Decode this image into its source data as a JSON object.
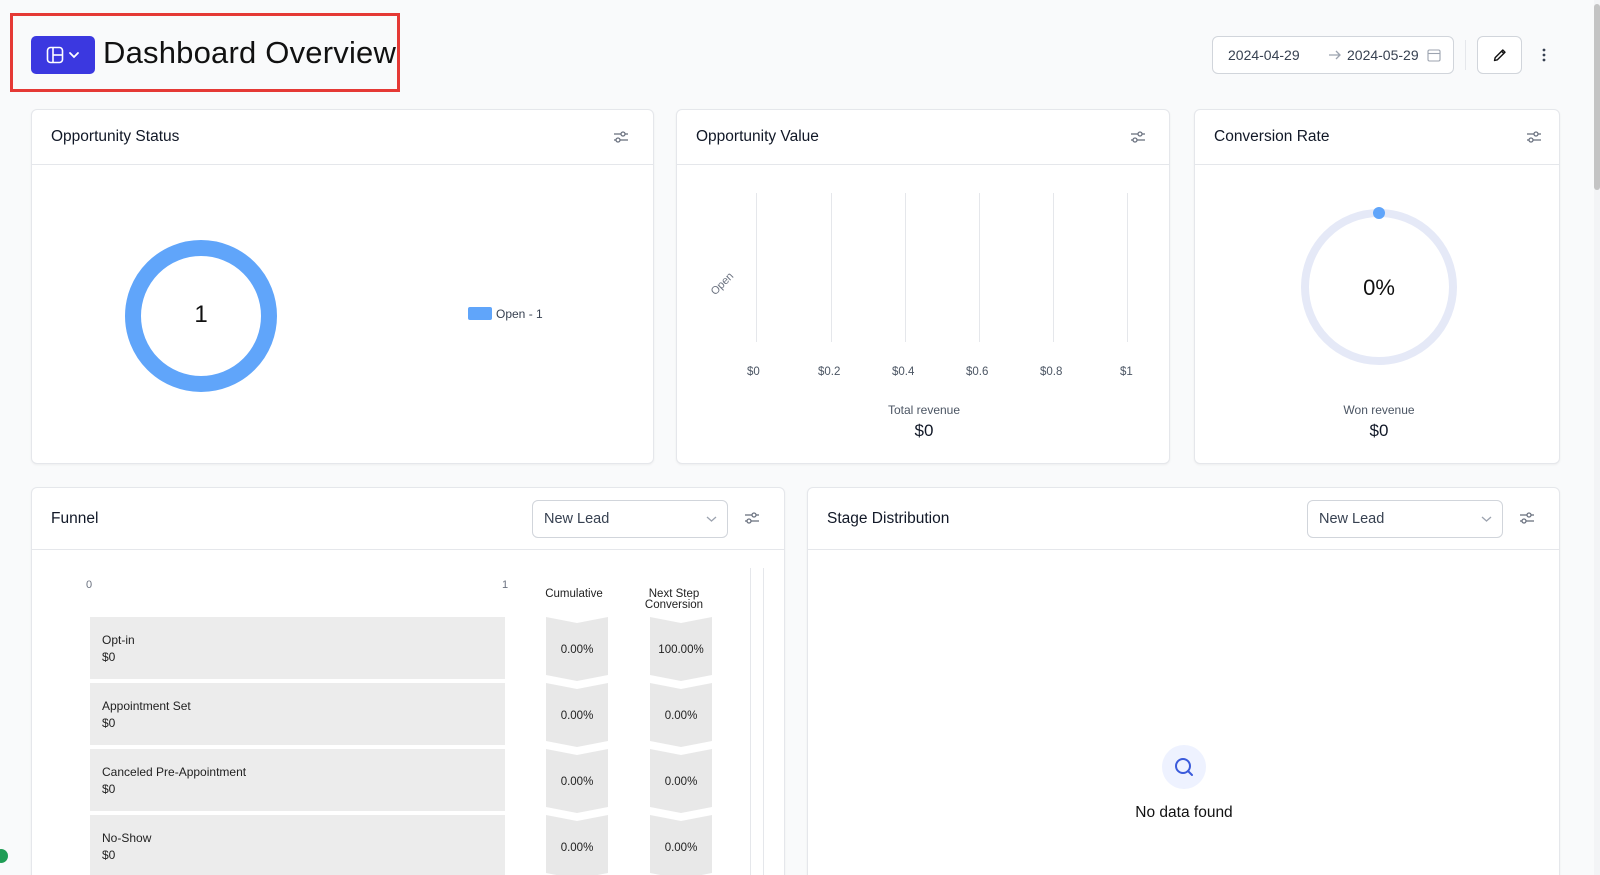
{
  "header": {
    "title": "Dashboard Overview",
    "date_start": "2024-04-29",
    "date_end": "2024-05-29"
  },
  "opportunity_status": {
    "title": "Opportunity Status",
    "center_value": "1",
    "legend": "Open - 1",
    "color": "#60a5fa"
  },
  "opportunity_value": {
    "title": "Opportunity Value",
    "category": "Open",
    "ticks": [
      "$0",
      "$0.2",
      "$0.4",
      "$0.6",
      "$0.8",
      "$1"
    ],
    "kpi_label": "Total revenue",
    "kpi_value": "$0"
  },
  "conversion_rate": {
    "title": "Conversion Rate",
    "center_value": "0%",
    "kpi_label": "Won revenue",
    "kpi_value": "$0"
  },
  "funnel": {
    "title": "Funnel",
    "select_value": "New Lead",
    "axis_min": "0",
    "axis_max": "1",
    "col_cumulative": "Cumulative",
    "col_next_line1": "Next Step",
    "col_next_line2": "Conversion",
    "rows": [
      {
        "label": "Opt-in",
        "amount": "$0",
        "cumulative": "0.00%",
        "next": "100.00%"
      },
      {
        "label": "Appointment Set",
        "amount": "$0",
        "cumulative": "0.00%",
        "next": "0.00%"
      },
      {
        "label": "Canceled Pre-Appointment",
        "amount": "$0",
        "cumulative": "0.00%",
        "next": "0.00%"
      },
      {
        "label": "No-Show",
        "amount": "$0",
        "cumulative": "0.00%",
        "next": "0.00%"
      }
    ]
  },
  "stage_distribution": {
    "title": "Stage Distribution",
    "select_value": "New Lead",
    "empty_text": "No data found"
  },
  "colors": {
    "accent": "#3b38e0",
    "highlight_border": "#e53935",
    "donut": "#60a5fa",
    "ring_track": "#e5e9f7"
  }
}
